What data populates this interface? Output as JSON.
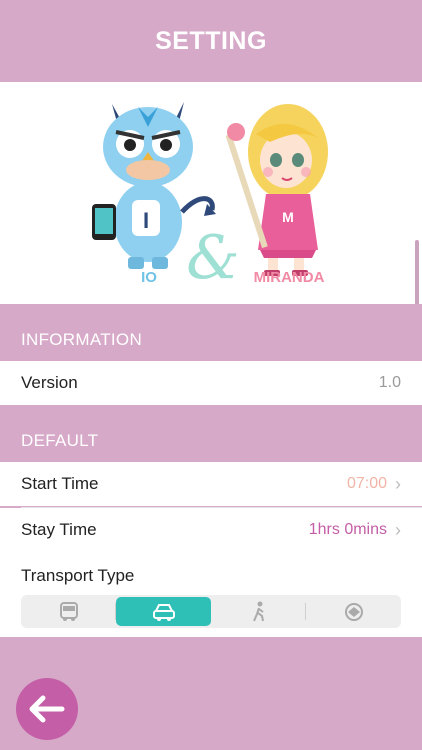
{
  "header": {
    "title": "SETTING"
  },
  "hero": {
    "left_name": "IO",
    "right_name": "MIRANDA",
    "ampersand": "&",
    "badge_left": "I",
    "badge_right": "M"
  },
  "sections": {
    "information": {
      "title": "INFORMATION",
      "version_label": "Version",
      "version_value": "1.0"
    },
    "default": {
      "title": "DEFAULT",
      "start_time_label": "Start Time",
      "start_time_value": "07:00",
      "stay_time_label": "Stay Time",
      "stay_time_value": "1hrs 0mins",
      "transport_label": "Transport Type",
      "transport_options": [
        "bus-icon",
        "car-icon",
        "walk-icon",
        "taxi-icon"
      ],
      "transport_selected": "car-icon"
    }
  },
  "colors": {
    "accent": "#2ebfb7",
    "pink": "#d7a9c8",
    "start_time": "#f0b5a6",
    "stay_time": "#c45ea6",
    "back_button": "#c45ea6"
  }
}
